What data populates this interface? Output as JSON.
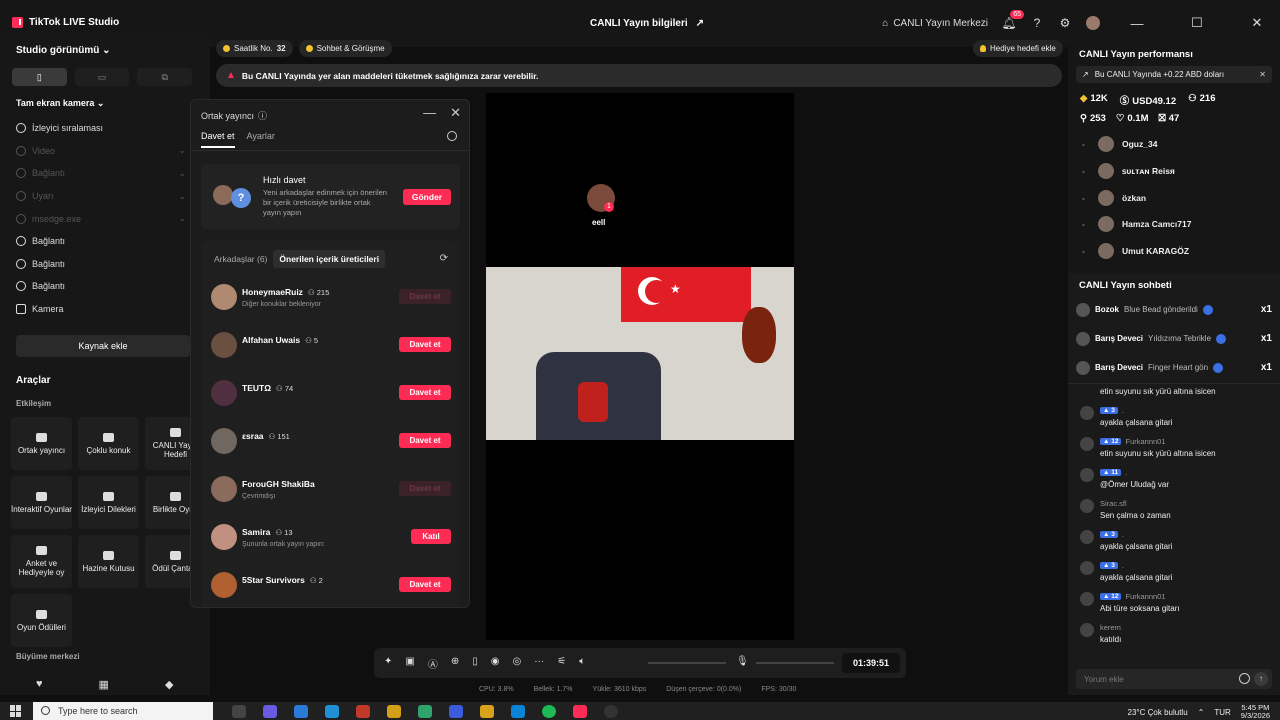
{
  "window": {
    "app_title": "TikTok LIVE Studio",
    "center_title": "CANLI Yayın bilgileri",
    "live_center": "CANLI Yayın Merkezi",
    "notification_count": "65"
  },
  "left": {
    "studio_view": "Studio görünümü",
    "source_header": "Tam ekran kamera",
    "sources": [
      {
        "label": "İzleyici sıralaması",
        "dim": false
      },
      {
        "label": "Video",
        "dim": true
      },
      {
        "label": "Bağlantı",
        "dim": true
      },
      {
        "label": "Uyarı",
        "dim": true
      },
      {
        "label": "msedge.exe",
        "dim": true
      },
      {
        "label": "Bağlantı",
        "dim": false
      },
      {
        "label": "Bağlantı",
        "dim": false
      },
      {
        "label": "Bağlantı",
        "dim": false
      },
      {
        "label": "Kamera",
        "dim": false
      }
    ],
    "add_source": "Kaynak ekle",
    "tools_header": "Araçlar",
    "interaction_header": "Etkileşim",
    "tools": [
      "Ortak yayıncı",
      "Çoklu konuk",
      "CANLI Yayın Hedefi",
      "İnteraktif Oyunlar",
      "İzleyici Dilekleri",
      "Birlikte Oyna",
      "Anket ve Hediyeyle oy",
      "Hazine Kutusu",
      "Ödül Çantası",
      "Oyun Ödülleri"
    ],
    "growth_header": "Büyüme merkezi"
  },
  "center": {
    "chip_hourly_label": "Saatlik No.",
    "chip_hourly_value": "32",
    "chip_chat": "Sohbet & Görüşme",
    "gift_goal": "Hediye hedefi ekle",
    "warning": "Bu CANLI Yayında yer alan maddeleri tüketmek sağlığınıza zarar verebilir.",
    "guest_name": "eell",
    "guest_badge": "1"
  },
  "cohost": {
    "title": "Ortak yayıncı",
    "tabs": [
      "Davet et",
      "Ayarlar"
    ],
    "quick_title": "Hızlı davet",
    "quick_desc": "Yeni arkadaşlar edinmek için önerilen bir içerik üreticisiyle birlikte ortak yayın yapın",
    "send": "Gönder",
    "friends_tab": "Arkadaşlar (6)",
    "suggested_tab": "Önerilen içerik üreticileri",
    "rows": [
      {
        "name": "HoneymaeRuiz",
        "count": "215",
        "sub": "Diğer konuklar bekleniyor",
        "action": "Davet et",
        "disabled": true
      },
      {
        "name": "Alfahan Uwais",
        "count": "5",
        "sub": "",
        "action": "Davet et",
        "disabled": false
      },
      {
        "name": "TEUTΩ",
        "count": "74",
        "sub": "",
        "action": "Davet et",
        "disabled": false
      },
      {
        "name": "εsraa",
        "count": "151",
        "sub": "",
        "action": "Davet et",
        "disabled": false
      },
      {
        "name": "ForouGH ShakiBa",
        "count": "",
        "sub": "Çevrimdışı",
        "action": "Davet et",
        "disabled": true
      },
      {
        "name": "Samira",
        "count": "13",
        "sub": "Şununla ortak yayın yapın:",
        "action": "Katıl",
        "disabled": false
      },
      {
        "name": "5Star Survivors",
        "count": "2",
        "sub": "",
        "action": "Davet et",
        "disabled": false
      }
    ]
  },
  "toolbar": {
    "timer": "01:39:51"
  },
  "stats": [
    "CPU: 3.8%",
    "Bellek: 1.7%",
    "Yükle: 3610 kbps",
    "Düşen çerçeve: 0(0.0%)",
    "FPS: 30/30"
  ],
  "right": {
    "perf_title": "CANLI Yayın performansı",
    "perf_banner": "Bu CANLI Yayında +0.22 ABD doları",
    "metrics_row1": [
      "12K",
      "USD49.12",
      "216"
    ],
    "metrics_row2": [
      "253",
      "0.1M",
      "47"
    ],
    "viewers": [
      "Oguz_34",
      "ꜱᴜʟᴛᴀɴ Reisᴙ",
      "özkan",
      "Hamza Camcı717",
      "Umut KARAGÖZ"
    ],
    "chat_title": "CANLI Yayın sohbeti",
    "gifts": [
      {
        "user": "Bozok",
        "text": "Blue Bead gönderildi",
        "mult": "x1"
      },
      {
        "user": "Barış Deveci",
        "text": "Yıldızıma Tebrikle",
        "mult": "x1"
      },
      {
        "user": "Barış Deveci",
        "text": "Finger Heart gön",
        "mult": "x1"
      }
    ],
    "messages": [
      {
        "level": "",
        "user": "",
        "text": "etin suyunu sık yürü altına isicen"
      },
      {
        "level": "3",
        "user": ".",
        "text": "ayakla çalsana gitari"
      },
      {
        "level": "12",
        "user": "Furkannn01",
        "text": "etin suyunu sık yürü altına isicen"
      },
      {
        "level": "11",
        "user": ".",
        "text": "@Ömer Uludağ var"
      },
      {
        "level": "",
        "user": "Sirac.sfl",
        "text": "Sen çalma o zaman"
      },
      {
        "level": "3",
        "user": ".",
        "text": "ayakla çalsana gitari"
      },
      {
        "level": "3",
        "user": ".",
        "text": "ayakla çalsana gitari"
      },
      {
        "level": "12",
        "user": "Furkannn01",
        "text": "Abi türe soksana gitarı"
      },
      {
        "level": "",
        "user": "kerem",
        "text": "katıldı"
      }
    ],
    "comment_placeholder": "Yorum ekle"
  },
  "taskbar": {
    "search_placeholder": "Type here to search",
    "weather": "23°C  Çok bulutlu",
    "lang": "TUR",
    "time": "5:45 PM",
    "date": "9/3/2026"
  },
  "colors": {
    "accent": "#fe2c55",
    "level_badge": "#3b6fe6",
    "gold": "#f2c230"
  }
}
